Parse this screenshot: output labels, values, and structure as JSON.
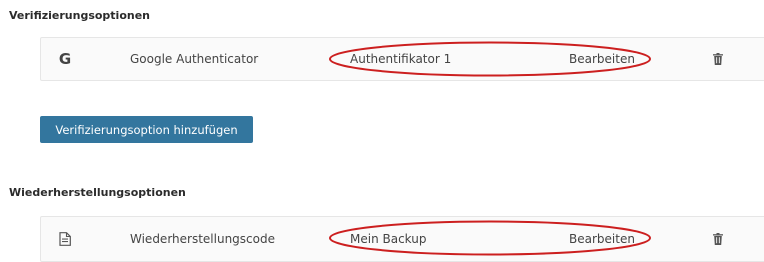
{
  "verification": {
    "title": "Verifizierungsoptionen",
    "item": {
      "icon": "google-g-icon",
      "icon_glyph": "G",
      "name": "Google Authenticator",
      "label": "Authentifikator 1",
      "edit_label": "Bearbeiten",
      "delete_icon": "trash-icon"
    },
    "add_button_label": "Verifizierungsoption hinzufügen"
  },
  "recovery": {
    "title": "Wiederherstellungsoptionen",
    "item": {
      "icon": "document-icon",
      "name": "Wiederherstellungscode",
      "label": "Mein Backup",
      "edit_label": "Bearbeiten",
      "delete_icon": "trash-icon"
    }
  },
  "colors": {
    "button_bg": "#33769e",
    "annotation_oval": "#cc1f1f",
    "card_bg": "#fafafa"
  }
}
